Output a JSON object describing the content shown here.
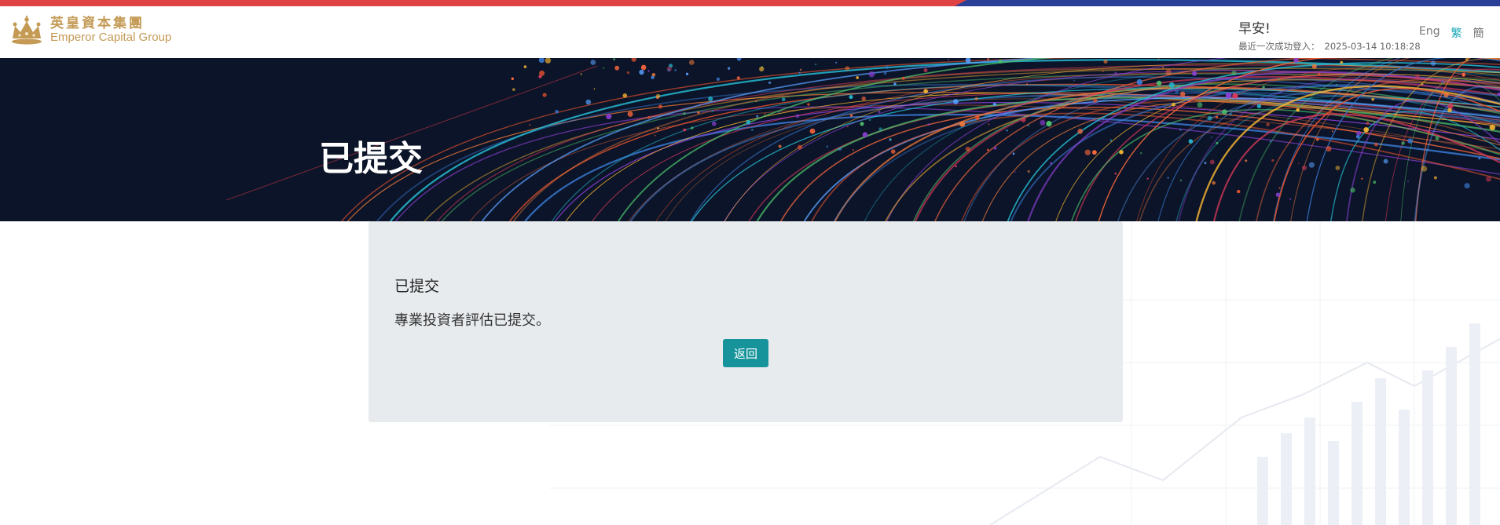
{
  "brand": {
    "name_cn": "英皇資本集團",
    "name_en": "Emperor Capital Group",
    "logo_icon": "crown-icon",
    "gold": "#c49a55"
  },
  "header": {
    "greeting": "早安!",
    "last_login_label": "最近一次成功登入：",
    "last_login_time": "2025-03-14 10:18:28",
    "languages": [
      "Eng",
      "繁",
      "簡"
    ],
    "active_language": "繁"
  },
  "banner": {
    "title": "已提交"
  },
  "panel": {
    "title": "已提交",
    "message": "專業投資者評估已提交。",
    "back_label": "返回"
  },
  "colors": {
    "stripe_red": "#e04343",
    "stripe_blue": "#2a3f97",
    "accent": "#17949b",
    "banner_bg": "#0b1428",
    "panel_bg": "#e8ebee"
  }
}
